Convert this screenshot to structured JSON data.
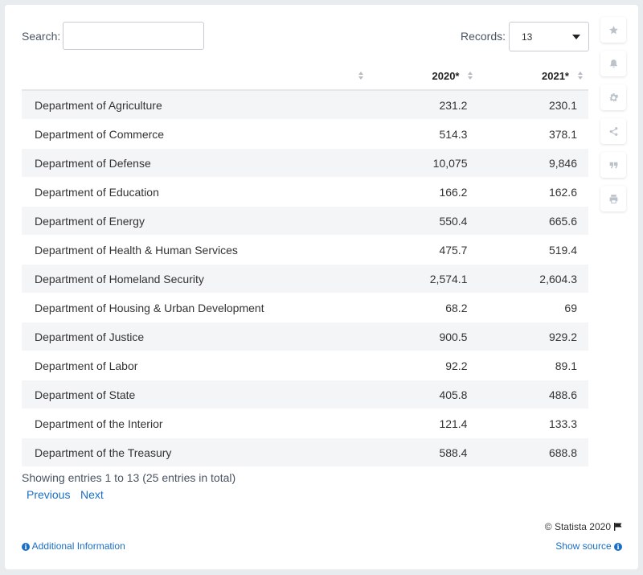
{
  "search": {
    "label": "Search:",
    "value": "",
    "placeholder": ""
  },
  "records": {
    "label": "Records:",
    "value": "13"
  },
  "table": {
    "columns": [
      "",
      "2020*",
      "2021*"
    ],
    "rows": [
      {
        "name": "Department of Agriculture",
        "y2020": "231.2",
        "y2021": "230.1"
      },
      {
        "name": "Department of Commerce",
        "y2020": "514.3",
        "y2021": "378.1"
      },
      {
        "name": "Department of Defense",
        "y2020": "10,075",
        "y2021": "9,846"
      },
      {
        "name": "Department of Education",
        "y2020": "166.2",
        "y2021": "162.6"
      },
      {
        "name": "Department of Energy",
        "y2020": "550.4",
        "y2021": "665.6"
      },
      {
        "name": "Department of Health & Human Services",
        "y2020": "475.7",
        "y2021": "519.4"
      },
      {
        "name": "Department of Homeland Security",
        "y2020": "2,574.1",
        "y2021": "2,604.3"
      },
      {
        "name": "Department of Housing & Urban Development",
        "y2020": "68.2",
        "y2021": "69"
      },
      {
        "name": "Department of Justice",
        "y2020": "900.5",
        "y2021": "929.2"
      },
      {
        "name": "Department of Labor",
        "y2020": "92.2",
        "y2021": "89.1"
      },
      {
        "name": "Department of State",
        "y2020": "405.8",
        "y2021": "488.6"
      },
      {
        "name": "Department of the Interior",
        "y2020": "121.4",
        "y2021": "133.3"
      },
      {
        "name": "Department of the Treasury",
        "y2020": "588.4",
        "y2021": "688.8"
      }
    ]
  },
  "footer": {
    "info": "Showing entries 1 to 13 (25 entries in total)",
    "previous": "Previous",
    "next": "Next",
    "copyright": "© Statista 2020",
    "additional_info": "Additional Information",
    "show_source": "Show source"
  },
  "side_toolbar": [
    "star-icon",
    "bell-icon",
    "gear-icon",
    "share-icon",
    "quote-icon",
    "print-icon"
  ],
  "colors": {
    "link": "#1a6fc4",
    "stripe": "#f4f5f7",
    "background": "#e9ecef"
  }
}
